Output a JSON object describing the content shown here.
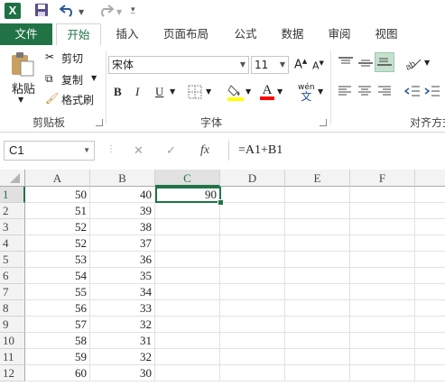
{
  "quick_access": {
    "app_icon": "X",
    "icons": [
      "excel-icon",
      "save-icon",
      "undo-icon",
      "redo-icon",
      "customize-icon"
    ]
  },
  "tabs": [
    {
      "label": "文件"
    },
    {
      "label": "开始"
    },
    {
      "label": "插入"
    },
    {
      "label": "页面布局"
    },
    {
      "label": "公式"
    },
    {
      "label": "数据"
    },
    {
      "label": "审阅"
    },
    {
      "label": "视图"
    }
  ],
  "ribbon": {
    "clipboard": {
      "paste": "粘贴",
      "cut": "剪切",
      "copy": "复制",
      "format_painter": "格式刷",
      "group_label": "剪贴板"
    },
    "font": {
      "font_name": "宋体",
      "font_size": "11",
      "grow": "A",
      "shrink": "A",
      "bold": "B",
      "italic": "I",
      "underline": "U",
      "font_color": "A",
      "phonetic": "wén",
      "group_label": "字体"
    },
    "alignment": {
      "group_label": "对齐方式"
    }
  },
  "formula_bar": {
    "name_box": "C1",
    "cancel": "✕",
    "enter": "✓",
    "fx": "fx",
    "formula": "=A1+B1"
  },
  "sheet": {
    "columns": [
      "A",
      "B",
      "C",
      "D",
      "E",
      "F"
    ],
    "selected_column": "C",
    "selected_row": "1",
    "rows": [
      {
        "num": "1",
        "a": "50",
        "b": "40",
        "c": "90"
      },
      {
        "num": "2",
        "a": "51",
        "b": "39",
        "c": ""
      },
      {
        "num": "3",
        "a": "52",
        "b": "38",
        "c": ""
      },
      {
        "num": "4",
        "a": "52",
        "b": "37",
        "c": ""
      },
      {
        "num": "5",
        "a": "53",
        "b": "36",
        "c": ""
      },
      {
        "num": "6",
        "a": "54",
        "b": "35",
        "c": ""
      },
      {
        "num": "7",
        "a": "55",
        "b": "34",
        "c": ""
      },
      {
        "num": "8",
        "a": "56",
        "b": "33",
        "c": ""
      },
      {
        "num": "9",
        "a": "57",
        "b": "32",
        "c": ""
      },
      {
        "num": "10",
        "a": "58",
        "b": "31",
        "c": ""
      },
      {
        "num": "11",
        "a": "59",
        "b": "32",
        "c": ""
      },
      {
        "num": "12",
        "a": "60",
        "b": "30",
        "c": ""
      }
    ]
  },
  "colors": {
    "accent": "#217346"
  }
}
